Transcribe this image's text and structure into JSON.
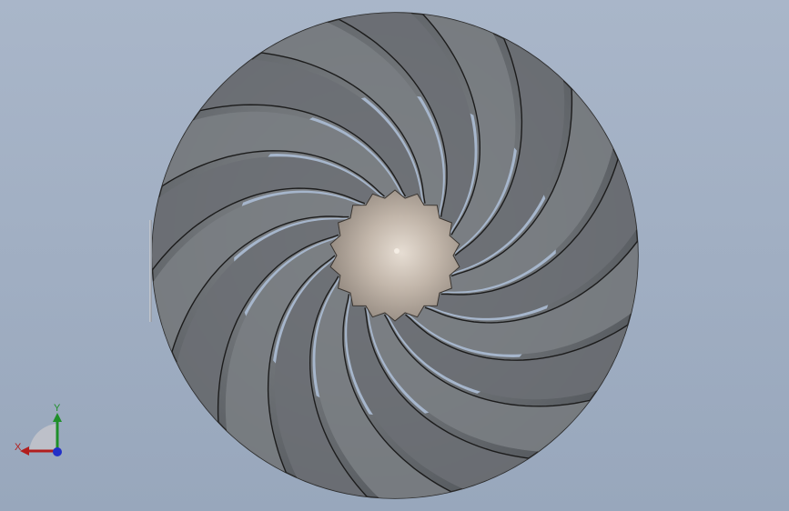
{
  "viewport": {
    "background_top": "#a9b6c9",
    "background_bottom": "#98a7bc"
  },
  "model": {
    "blade_count": 18,
    "blade_fill": "#6f7378",
    "blade_edge": "#1c1c1c",
    "gap_color": "#a6b6cc",
    "hub_color": "#b4aaa0",
    "hub_teeth": 18
  },
  "triad": {
    "x_label": "X",
    "y_label": "Y",
    "x_color": "#b21e1e",
    "y_color": "#1f8f2a",
    "z_color": "#2230c8"
  }
}
